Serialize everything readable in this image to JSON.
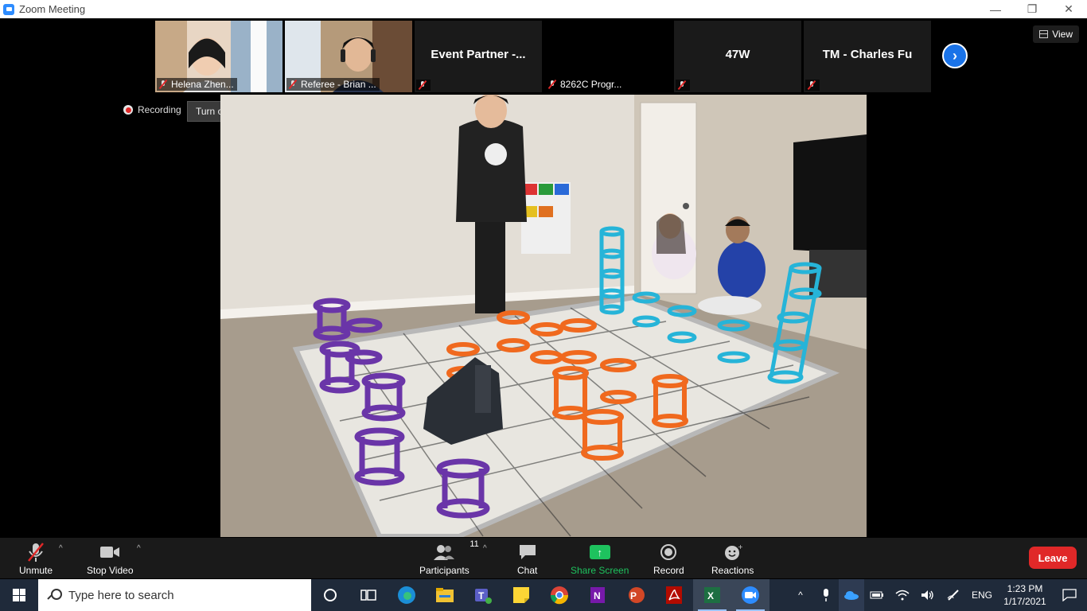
{
  "window": {
    "title": "Zoom Meeting",
    "minimize": "—",
    "restore": "❐",
    "close": "✕"
  },
  "participants_strip": [
    {
      "label": "Helena Zhen...",
      "type": "video"
    },
    {
      "label": "Referee - Brian ...",
      "type": "video"
    },
    {
      "big_name": "Event Partner -...",
      "type": "name"
    },
    {
      "label": "8262C Progr...",
      "type": "black"
    },
    {
      "big_name": "47W",
      "type": "name"
    },
    {
      "big_name": "TM - Charles Fu",
      "type": "name"
    }
  ],
  "view_button": "View",
  "recording_label": "Recording",
  "original_sound_label": "Turn on Original Sound",
  "toolbar": {
    "unmute": "Unmute",
    "stop_video": "Stop Video",
    "participants": "Participants",
    "participants_count": "11",
    "chat": "Chat",
    "share_screen": "Share Screen",
    "record": "Record",
    "reactions": "Reactions",
    "leave": "Leave"
  },
  "taskbar": {
    "search_placeholder": "Type here to search",
    "apps": [
      "cortana-icon",
      "task-view-icon",
      "edge-icon",
      "file-explorer-icon",
      "teams-icon",
      "sticky-notes-icon",
      "chrome-icon",
      "onenote-icon",
      "powerpoint-icon",
      "acrobat-icon",
      "excel-icon",
      "zoom-icon"
    ],
    "language": "ENG",
    "time": "1:23 PM",
    "date": "1/17/2021"
  },
  "colors": {
    "leave": "#e02828",
    "share": "#1ec25e",
    "accent": "#1a73e8"
  }
}
